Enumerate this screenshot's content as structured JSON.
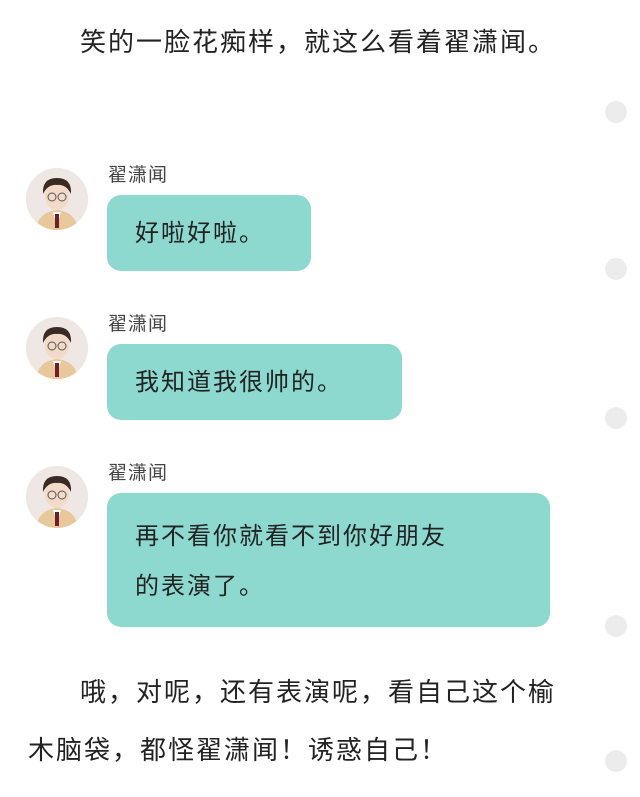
{
  "paragraphs": [
    {
      "text": "笑的一脸花痴样，就这么看着翟潇闻。"
    },
    {
      "text": "哦，对呢，还有表演呢，看自己这个榆木脑袋，都怪翟潇闻！诱惑自己！"
    }
  ],
  "messages": [
    {
      "sender": "翟潇闻",
      "text": "好啦好啦。"
    },
    {
      "sender": "翟潇闻",
      "text": "我知道我很帅的。"
    },
    {
      "sender": "翟潇闻",
      "lines": [
        "再不看你就看不到你好朋友",
        "的表演了。"
      ]
    }
  ],
  "colors": {
    "bubble": "#8dd9d0",
    "dot": "#ececec",
    "background": "#ffffff"
  },
  "icons": {
    "avatar": "avatar-portrait",
    "side_dot": "circle-dot"
  }
}
